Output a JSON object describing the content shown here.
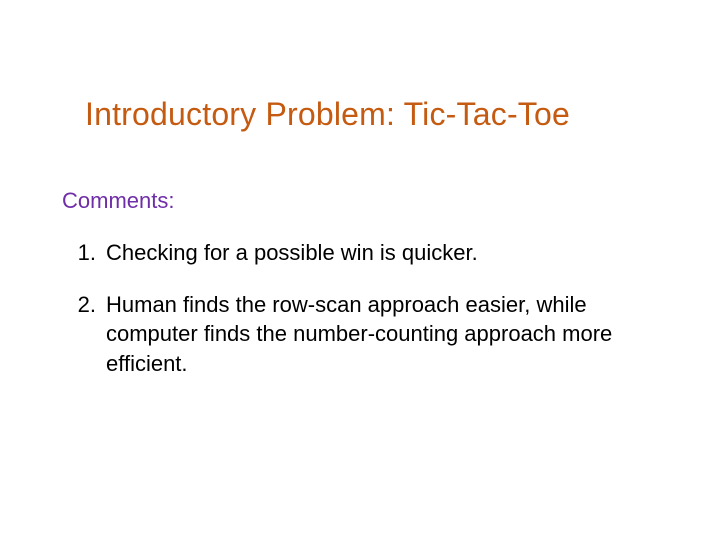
{
  "title": "Introductory Problem: Tic-Tac-Toe",
  "subhead": "Comments:",
  "items": [
    {
      "num": "1.",
      "text": "Checking for a possible win is quicker."
    },
    {
      "num": "2.",
      "text": "Human finds the row-scan approach easier, while computer finds the number-counting approach more efficient."
    }
  ],
  "colors": {
    "title": "#c55a11",
    "subhead": "#6f2da8",
    "body": "#000000",
    "background": "#ffffff"
  }
}
